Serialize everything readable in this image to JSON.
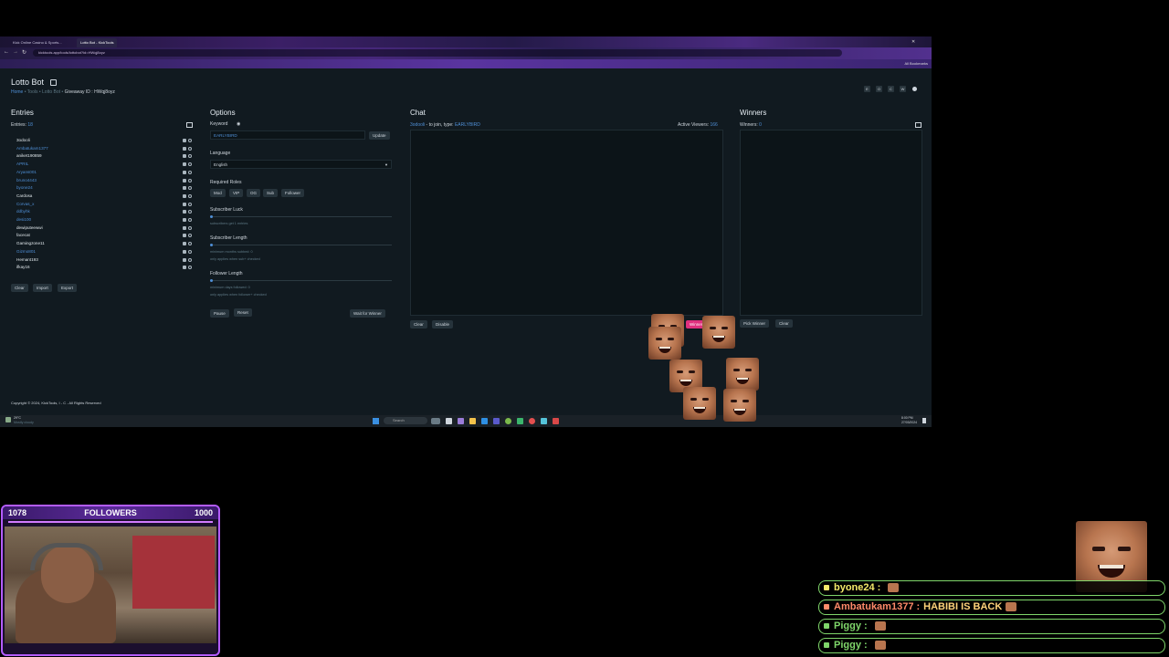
{
  "browser": {
    "tabs": [
      "Kick Online Casino & Sports...",
      "Lotto Bot - KickTools"
    ],
    "address": "kicktools.app/tools/lottobot?id=HWqj8oyz",
    "bookmarks_label": "All Bookmarks"
  },
  "app": {
    "title": "Lotto Bot",
    "breadcrumb": [
      "Home",
      "Tools",
      "Lotto Bot"
    ],
    "giveaway_label": "Giveaway ID :",
    "giveaway_id": "HWqj8oyz",
    "header_icons": [
      "E",
      "O",
      "C",
      "W"
    ]
  },
  "entries": {
    "heading": "Entries",
    "count_label": "Entries:",
    "count": "18",
    "items": [
      {
        "name": "3odooli",
        "color": "#dfe6ea"
      },
      {
        "name": "Ambatukam1377",
        "color": "#4f8fd6"
      },
      {
        "name": "aniket190859",
        "color": "#dfe6ea"
      },
      {
        "name": "APRIL",
        "color": "#4f8fd6"
      },
      {
        "name": "Aryans001",
        "color": "#4f8fd6"
      },
      {
        "name": "bruno4443",
        "color": "#4f8fd6"
      },
      {
        "name": "byone24",
        "color": "#4f8fd6"
      },
      {
        "name": "Cardosa",
        "color": "#dfe6ea"
      },
      {
        "name": "Corvas_x",
        "color": "#4f8fd6"
      },
      {
        "name": "ddbyhk",
        "color": "#4f8fd6"
      },
      {
        "name": "desi100",
        "color": "#4f8fd6"
      },
      {
        "name": "dewiputeewwi",
        "color": "#dfe6ea"
      },
      {
        "name": "facecat",
        "color": "#dfe6ea"
      },
      {
        "name": "Gamingzone11",
        "color": "#dfe6ea"
      },
      {
        "name": "Gizmo801",
        "color": "#4f8fd6"
      },
      {
        "name": "Hemant193",
        "color": "#dfe6ea"
      },
      {
        "name": "ifkay16",
        "color": "#dfe6ea"
      }
    ],
    "buttons": [
      "Clear",
      "Import",
      "Export"
    ]
  },
  "options": {
    "heading": "Options",
    "keyword_label": "Keyword",
    "keyword_value": "EARLYBIRD",
    "update_label": "Update",
    "language_label": "Language",
    "language_value": "English",
    "roles_label": "Required Roles",
    "roles": [
      "Mod",
      "VIP",
      "OG",
      "Sub",
      "Follower"
    ],
    "sub_luck_label": "Subscriber Luck",
    "sub_luck_hint": "subscribers get 1 entries",
    "sub_length_label": "Subscriber Length",
    "sub_length_hint1": "minimum months subbed: 0",
    "sub_length_hint2": "only applies when sub+ checked",
    "follower_length_label": "Follower Length",
    "follower_length_hint1": "minimum days followed: 0",
    "follower_length_hint2": "only applies when follower+ checked",
    "pause_label": "Pause",
    "reset_label": "Reset",
    "wait_label": "Wait for Winner"
  },
  "chat": {
    "heading": "Chat",
    "instruction_user": "3odooli",
    "instruction_mid": "- to join, type:",
    "instruction_keyword": "EARLYBIRD",
    "viewers_label": "Active Viewers:",
    "viewers_count": "166",
    "clear_label": "Clear",
    "disable_label": "Disable",
    "winner_chat_label": "Winner Chat"
  },
  "winners": {
    "heading": "Winners",
    "count_label": "Winners:",
    "count": "0",
    "pick_label": "Pick Winner",
    "clear_label": "Clear"
  },
  "footer": {
    "copyright": "Copyright © 2024, KickTools, I - C - All Rights Reserved"
  },
  "taskbar": {
    "weather_temp": "29°C",
    "weather_desc": "Mostly cloudy",
    "search": "Search",
    "time": "8:00 PM",
    "date": "27/03/2024"
  },
  "stream": {
    "followers_current": "1078",
    "followers_label": "FOLLOWERS",
    "followers_goal": "1000",
    "followers_progress": 1.0
  },
  "stream_chat": [
    {
      "user": "byone24 :",
      "message": "",
      "user_color": "#f4e96a"
    },
    {
      "user": "Ambatukam1377 :",
      "message": "HABIBI IS BACK",
      "user_color": "#ff8a6a"
    },
    {
      "user": "Piggy :",
      "message": "",
      "user_color": "#7fd66a"
    },
    {
      "user": "Piggy :",
      "message": "",
      "user_color": "#7fd66a"
    }
  ]
}
